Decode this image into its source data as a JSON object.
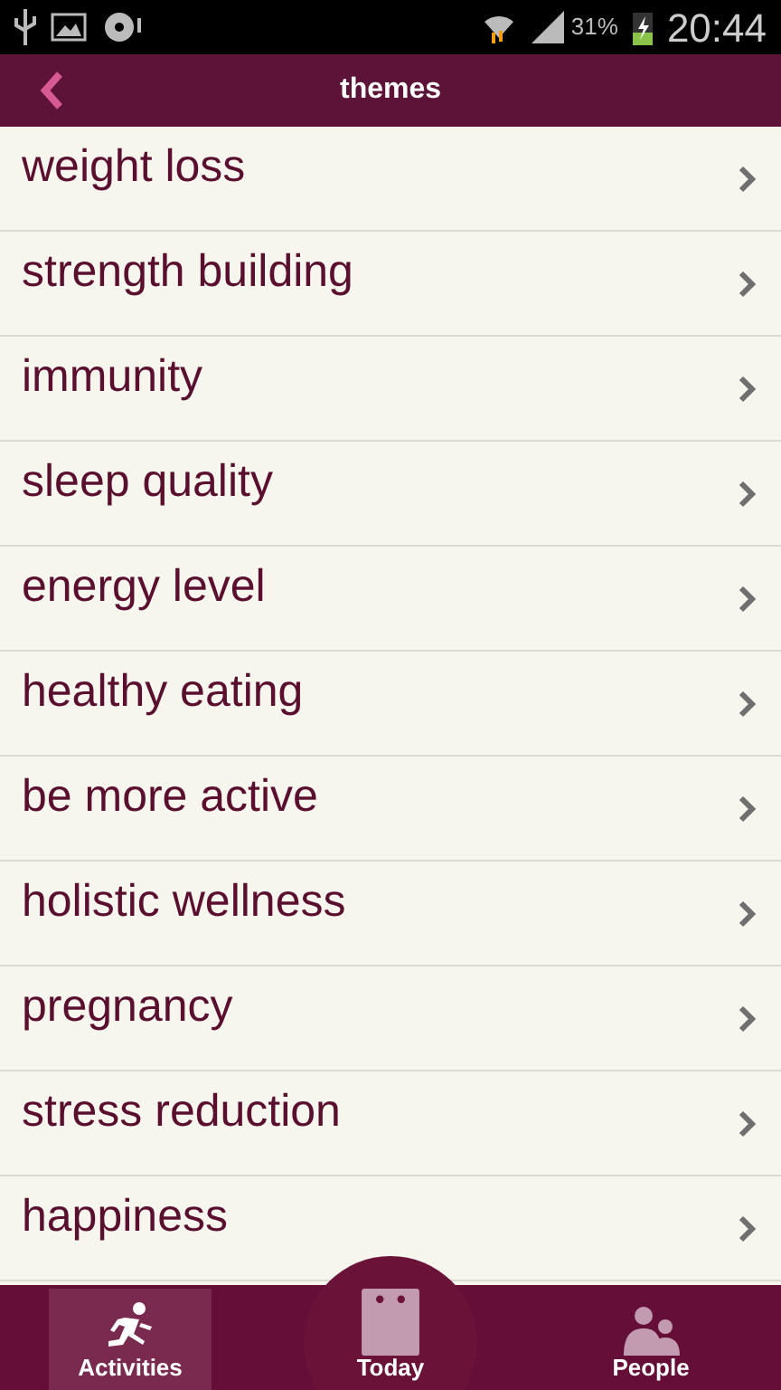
{
  "status_bar": {
    "battery": "31%",
    "time": "20:44"
  },
  "header": {
    "title": "themes"
  },
  "themes": [
    {
      "label": "weight loss"
    },
    {
      "label": "strength building"
    },
    {
      "label": "immunity"
    },
    {
      "label": "sleep quality"
    },
    {
      "label": "energy level"
    },
    {
      "label": "healthy eating"
    },
    {
      "label": "be more active"
    },
    {
      "label": "holistic wellness"
    },
    {
      "label": "pregnancy"
    },
    {
      "label": "stress reduction"
    },
    {
      "label": "happiness"
    }
  ],
  "bottom_nav": [
    {
      "kind": "activities",
      "label": "Activities",
      "selected": true
    },
    {
      "kind": "today",
      "label": "Today",
      "selected": false
    },
    {
      "kind": "people",
      "label": "People",
      "selected": false
    }
  ]
}
